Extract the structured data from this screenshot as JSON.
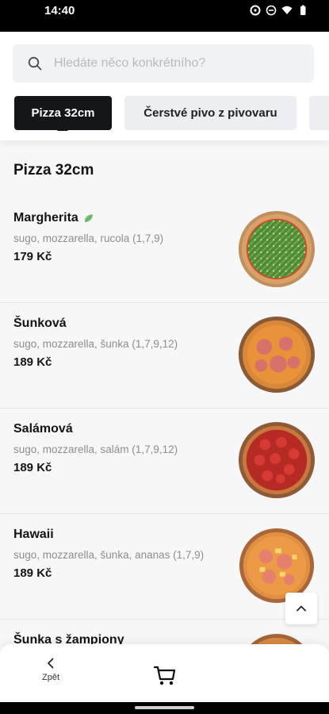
{
  "status_bar": {
    "time": "14:40",
    "icons": [
      "data-saver-icon",
      "dnd-icon",
      "wifi-icon",
      "battery-icon"
    ]
  },
  "search": {
    "placeholder": "Hledáte něco konkrétního?"
  },
  "tabs": [
    {
      "label": "Pizza 32cm",
      "active": true
    },
    {
      "label": "Čerstvé pivo z pivovaru",
      "active": false
    }
  ],
  "section": {
    "title": "Pizza 32cm"
  },
  "items": [
    {
      "name": "Margherita",
      "desc": "sugo, mozzarella, rucola (1,7,9)",
      "price": "179 Kč",
      "vegetarian": true
    },
    {
      "name": "Šunková",
      "desc": "sugo, mozzarella, šunka (1,7,9,12)",
      "price": "189 Kč"
    },
    {
      "name": "Salámová",
      "desc": "sugo, mozzarella, salám (1,7,9,12)",
      "price": "189 Kč"
    },
    {
      "name": "Hawaii",
      "desc": "sugo, mozzarella, šunka, ananas (1,7,9)",
      "price": "189 Kč"
    },
    {
      "name": "Šunka s žampiony",
      "desc": "",
      "price": ""
    }
  ],
  "bottom_bar": {
    "back_label": "Zpět"
  },
  "colors": {
    "accent": "#15161a",
    "tab_inactive": "#eceef1",
    "background": "#f7f7f8"
  }
}
